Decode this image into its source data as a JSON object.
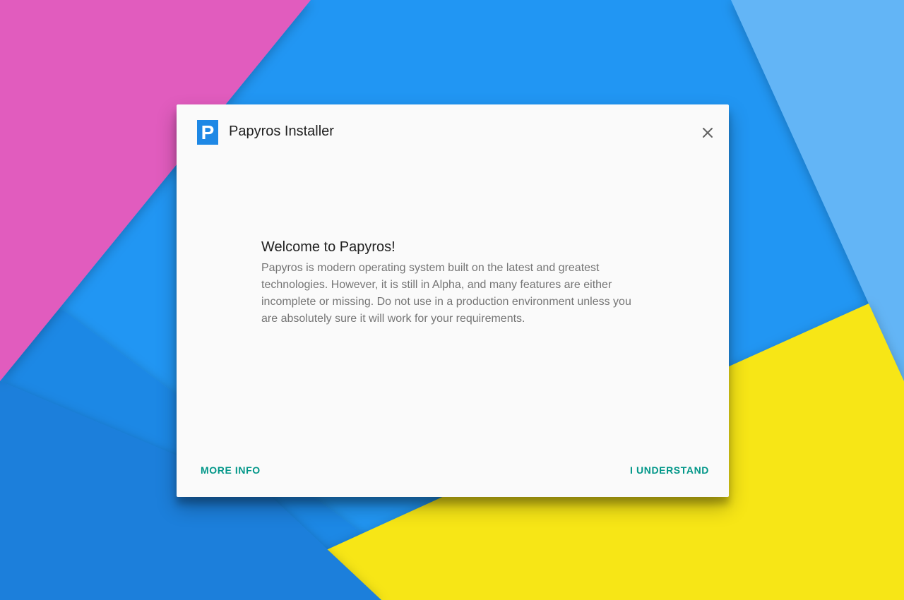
{
  "dialog": {
    "app_title": "Papyros Installer",
    "logo_letter": "P",
    "close_icon": "close-icon"
  },
  "content": {
    "welcome_title": "Welcome to Papyros!",
    "welcome_text": "Papyros is modern operating system built on the latest and greatest technologies. However, it is still in Alpha, and many features are either incomplete or missing. Do not use in a production environment unless you are absolutely sure it will work for your requirements."
  },
  "actions": {
    "more_info_label": "MORE INFO",
    "understand_label": "I UNDERSTAND"
  },
  "colors": {
    "accent": "#009688",
    "logo": "#1E88E5",
    "wallpaper_blue": "#2196F3",
    "wallpaper_pink": "#E15BBE",
    "wallpaper_yellow": "#F7E615",
    "wallpaper_light_blue": "#64B5F6"
  }
}
